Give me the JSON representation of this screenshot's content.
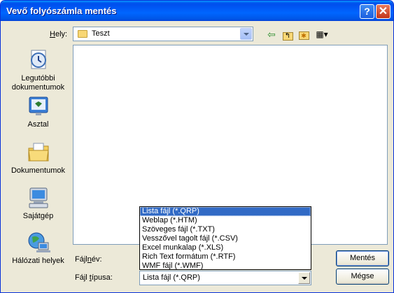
{
  "window": {
    "title": "Vevő folyószámla mentés",
    "help_symbol": "?",
    "close_symbol": "✕"
  },
  "location": {
    "label_accel": "H",
    "label_rest": "ely:",
    "value": "Teszt"
  },
  "toolbar": {
    "back_icon": "⇦",
    "up_icon": "↰",
    "newfolder_icon": "✱",
    "views_icon": "▦▾"
  },
  "places": [
    {
      "label": "Legutóbbi dokumentumok",
      "icon": "recent-documents-icon"
    },
    {
      "label": "Asztal",
      "icon": "desktop-icon"
    },
    {
      "label": "Dokumentumok",
      "icon": "my-documents-icon"
    },
    {
      "label": "Sajátgép",
      "icon": "my-computer-icon"
    },
    {
      "label": "Hálózati helyek",
      "icon": "network-places-icon"
    }
  ],
  "filename": {
    "label_pre": "Fájl",
    "label_accel": "n",
    "label_post": "év:",
    "value": ""
  },
  "filetype": {
    "label_pre": "Fájl ",
    "label_accel": "t",
    "label_post": "ípusa:",
    "value": "Lista fájl (*.QRP)",
    "options": [
      "Lista fájl (*.QRP)",
      "Weblap (*.HTM)",
      "Szöveges fájl (*.TXT)",
      "Vesszővel tagolt fájl (*.CSV)",
      "Excel munkalap (*.XLS)",
      "Rich Text formátum (*.RTF)",
      "WMF fájl (*.WMF)"
    ],
    "selected_index": 0
  },
  "buttons": {
    "save": "Mentés",
    "cancel": "Mégse"
  },
  "colors": {
    "title_bar": "#0058ee",
    "selection": "#316ac5",
    "dialog_bg": "#ece9d8"
  }
}
